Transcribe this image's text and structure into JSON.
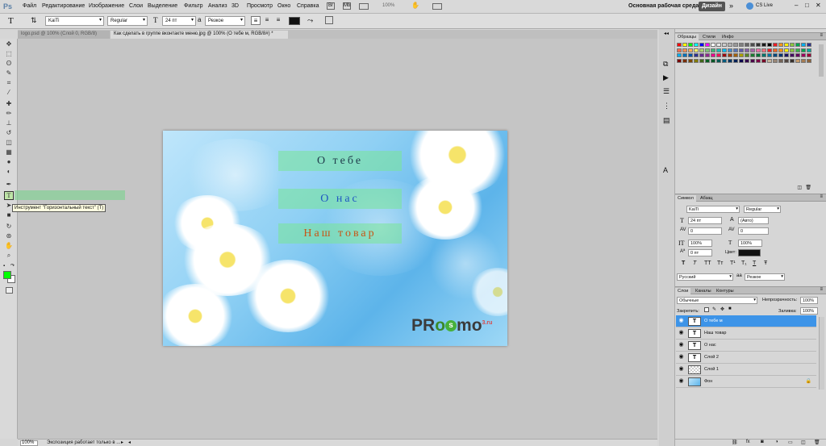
{
  "app": {
    "logo": "Ps"
  },
  "menu": [
    "Файл",
    "Редактирование",
    "Изображение",
    "Слои",
    "Выделение",
    "Фильтр",
    "Анализ",
    "3D",
    "Просмотр",
    "Окно",
    "Справка"
  ],
  "menu_right": {
    "zoom": "100%",
    "workspace": "Основная рабочая среда",
    "design_button": "Дизайн",
    "cs_live": "CS Live"
  },
  "options": {
    "font_family": "KaiTi",
    "font_style": "Regular",
    "font_size": "24 пт",
    "antialias": "Резкое"
  },
  "doc_tabs": [
    {
      "label": "logo.psd @ 100% (Слой 0, RGB/8)"
    },
    {
      "label": "Как сделать в группе вконтакте меню.jpg @ 100% (О тебе м, RGB/8#) *"
    }
  ],
  "tool_tooltip": "Инструмент \"Горизонтальный текст\" (T)",
  "canvas": {
    "menu": [
      "О тебе",
      "О нас",
      "Наш товар"
    ],
    "logo_main_1": "PR",
    "logo_o": "o",
    "logo_circle": "s",
    "logo_main_2": "mo",
    "logo_sup": "3.ru"
  },
  "status": {
    "zoom": "100%",
    "message": "Экспозиция работает только в ..."
  },
  "swatches_panel": {
    "tabs": [
      "Образцы",
      "Стили",
      "Инфо"
    ]
  },
  "character_panel": {
    "tabs": [
      "Символ",
      "Абзац"
    ],
    "font_family": "KaiTi",
    "font_style": "Regular",
    "size": "24 пт",
    "leading": "(Авто)",
    "kerning": "0",
    "tracking": "0",
    "vscale": "100%",
    "hscale": "100%",
    "baseline": "0 пт",
    "color_label": "Цвет:",
    "style_buttons": [
      "T",
      "T",
      "TT",
      "Tт",
      "T¹",
      "T₁",
      "T",
      "Ŧ"
    ],
    "language": "Русский",
    "antialias": "Резкое"
  },
  "layers_panel": {
    "tabs": [
      "Слои",
      "Каналы",
      "Контуры"
    ],
    "blend_mode": "Обычные",
    "opacity_label": "Непрозрачность:",
    "opacity": "100%",
    "lock_label": "Закрепить:",
    "fill_label": "Заливка:",
    "fill": "100%",
    "layers": [
      {
        "name": "О тебе м",
        "type": "text",
        "selected": true
      },
      {
        "name": "Наш товар",
        "type": "text",
        "selected": false
      },
      {
        "name": "О нас",
        "type": "text",
        "selected": false
      },
      {
        "name": "Слой 2",
        "type": "text",
        "selected": false
      },
      {
        "name": "Слой 1",
        "type": "empty",
        "selected": false
      },
      {
        "name": "Фон",
        "type": "image",
        "selected": false,
        "locked": true
      }
    ]
  },
  "colors": {
    "accent": "#3d94e8",
    "foreground": "#00ff00",
    "background": "#ffffff",
    "menu_highlight": "#78e696"
  }
}
